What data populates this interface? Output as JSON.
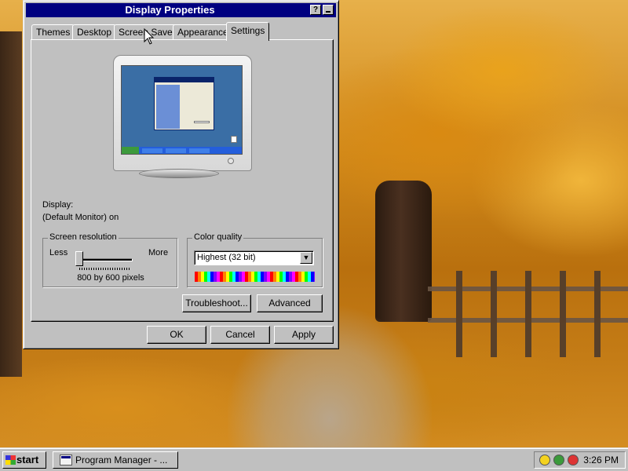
{
  "window": {
    "title": "Display Properties",
    "help_label": "?"
  },
  "tabs": [
    {
      "label": "Themes"
    },
    {
      "label": "Desktop"
    },
    {
      "label": "Screen Saver"
    },
    {
      "label": "Appearance"
    },
    {
      "label": "Settings",
      "active": true
    }
  ],
  "settings": {
    "display_label": "Display:",
    "display_value": "(Default Monitor) on",
    "resolution": {
      "group_title": "Screen resolution",
      "less_label": "Less",
      "more_label": "More",
      "value": "800 by 600 pixels",
      "slider_level": 0
    },
    "color_quality": {
      "group_title": "Color quality",
      "selected": "Highest (32 bit)"
    },
    "troubleshoot_label": "Troubleshoot...",
    "advanced_label": "Advanced"
  },
  "buttons": {
    "ok": "OK",
    "cancel": "Cancel",
    "apply": "Apply"
  },
  "taskbar": {
    "start_label": "start",
    "task_label": "Program Manager - ...",
    "clock": "3:26 PM"
  },
  "colors": {
    "titlebar": "#000080",
    "face": "#c0c0c0"
  }
}
